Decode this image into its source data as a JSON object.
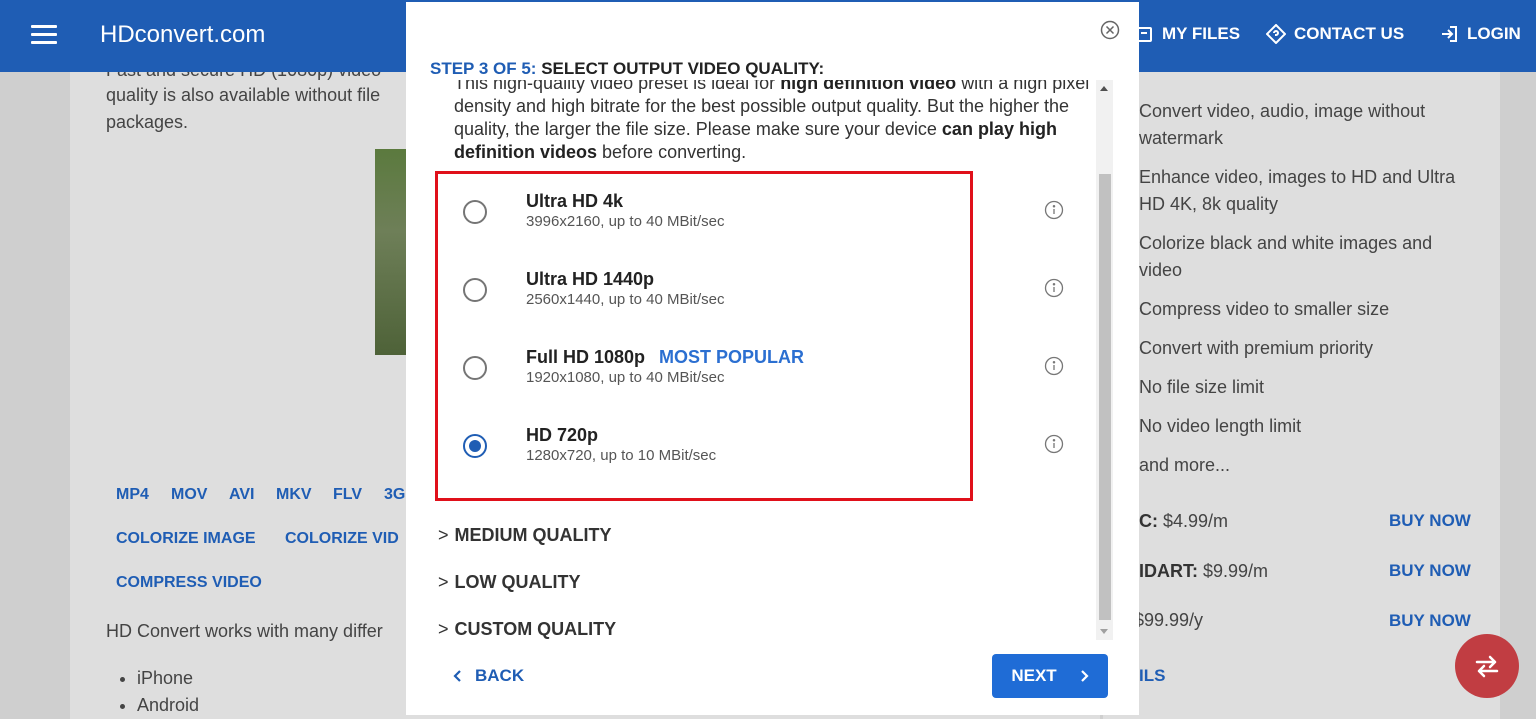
{
  "header": {
    "brand": "HDconvert.com",
    "nav": {
      "my_files": "MY FILES",
      "contact_us": "CONTACT US",
      "login": "LOGIN"
    }
  },
  "background_page": {
    "intro_cut": "Fast and secure HD (1080p) video",
    "intro_line2": "quality is also available without file",
    "intro_line3": "packages.",
    "format_links": [
      "MP4",
      "MOV",
      "AVI",
      "MKV",
      "FLV",
      "3G"
    ],
    "tool_links": [
      "COLORIZE IMAGE",
      "COLORIZE VID"
    ],
    "compress_link": "COMPRESS VIDEO",
    "devices_text": "HD Convert works with many differ",
    "devices": [
      "iPhone",
      "Android"
    ]
  },
  "premium": {
    "features": [
      "Convert video, audio, image without watermark",
      "Enhance video, images to HD and Ultra HD 4K, 8k quality",
      "Colorize black and white images and video",
      "Compress video to smaller size",
      "Convert with premium priority",
      "No file size limit",
      "No video length limit",
      "and more..."
    ],
    "plans": [
      {
        "name": "C:",
        "price": "$4.99/m",
        "buy": "BUY NOW"
      },
      {
        "name": "IDART:",
        "price": "$9.99/m",
        "buy": "BUY NOW"
      },
      {
        "name": "",
        "price": "$99.99/y",
        "buy": "BUY NOW"
      }
    ],
    "details": "ILS"
  },
  "modal": {
    "step_label": "STEP 3 OF 5:",
    "step_title": "SELECT OUTPUT VIDEO QUALITY:",
    "desc_intro": "This high-quality video preset is ideal for",
    "desc_bold1": "high definition video",
    "desc_mid": "with a high pixel density and high bitrate for the best possible output quality. But the higher the quality, the larger the file size. Please make sure your device",
    "desc_bold2": "can play high definition videos",
    "desc_end": "before converting.",
    "options": [
      {
        "label": "Ultra HD 4k",
        "sub": "3996x2160, up to 40 MBit/sec",
        "badge": "",
        "selected": false
      },
      {
        "label": "Ultra HD 1440p",
        "sub": "2560x1440, up to 40 MBit/sec",
        "badge": "",
        "selected": false
      },
      {
        "label": "Full HD 1080p",
        "sub": "1920x1080, up to 40 MBit/sec",
        "badge": "MOST POPULAR",
        "selected": false
      },
      {
        "label": "HD 720p",
        "sub": "1280x720, up to 10 MBit/sec",
        "badge": "",
        "selected": true
      }
    ],
    "sections": [
      "MEDIUM QUALITY",
      "LOW QUALITY",
      "CUSTOM QUALITY"
    ],
    "back_label": "BACK",
    "next_label": "NEXT"
  },
  "colors": {
    "header": "#1f5db4",
    "accent": "#1f6cd6",
    "highlight": "#e0101a",
    "fab": "#c13d42"
  },
  "icons": [
    "menu-icon",
    "folder-icon",
    "contact-icon",
    "login-icon",
    "close-icon",
    "info-icon",
    "chevron-right-icon",
    "chevron-left-icon",
    "swap-icon"
  ]
}
